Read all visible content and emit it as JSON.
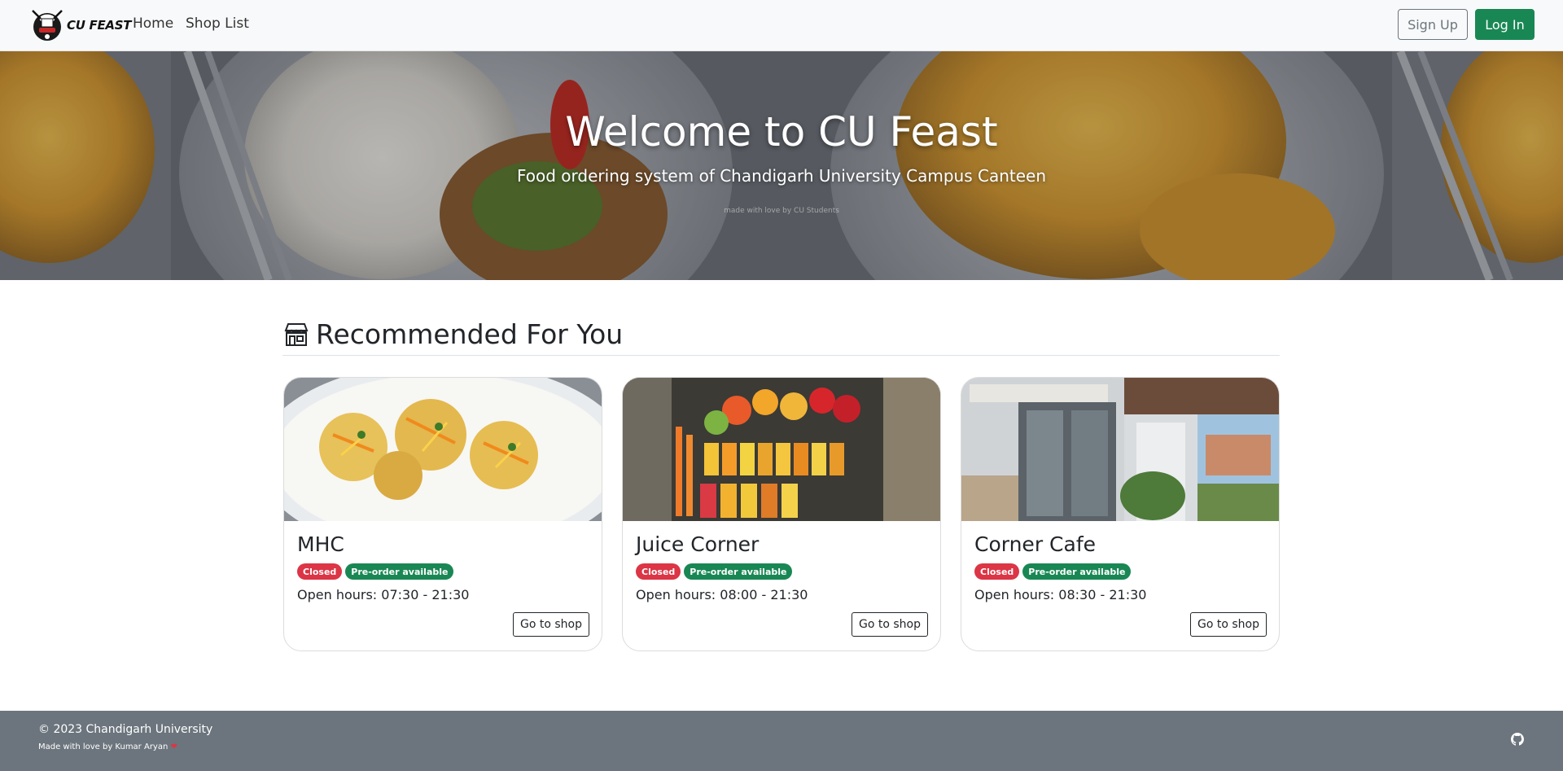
{
  "navbar": {
    "brand_text": "CU FEAST",
    "links": [
      {
        "label": "Home"
      },
      {
        "label": "Shop List"
      }
    ],
    "signup_label": "Sign Up",
    "login_label": "Log In"
  },
  "hero": {
    "title": "Welcome to CU Feast",
    "subtitle": "Food ordering system of Chandigarh University Campus Canteen",
    "note": "made with love by CU Students"
  },
  "recommended": {
    "heading": "Recommended For You",
    "icon": "store-icon",
    "shops": [
      {
        "name": "MHC",
        "image": "pani-puri-dish-photo",
        "status": "Closed",
        "preorder": "Pre-order available",
        "hours": "Open hours: 07:30 - 21:30",
        "cta": "Go to shop"
      },
      {
        "name": "Juice Corner",
        "image": "fruit-juice-stall-photo",
        "status": "Closed",
        "preorder": "Pre-order available",
        "hours": "Open hours: 08:00 - 21:30",
        "cta": "Go to shop"
      },
      {
        "name": "Corner Cafe",
        "image": "cafe-storefront-photo",
        "status": "Closed",
        "preorder": "Pre-order available",
        "hours": "Open hours: 08:30 - 21:30",
        "cta": "Go to shop"
      }
    ]
  },
  "footer": {
    "copyright": "© 2023 Chandigarh University",
    "made_with": "Made with love by Kumar Aryan",
    "heart": "❤",
    "social_icon": "github-icon"
  },
  "colors": {
    "success": "#198754",
    "danger": "#dc3545",
    "secondary": "#6c757d",
    "navbar_bg": "#f8f9fa"
  }
}
